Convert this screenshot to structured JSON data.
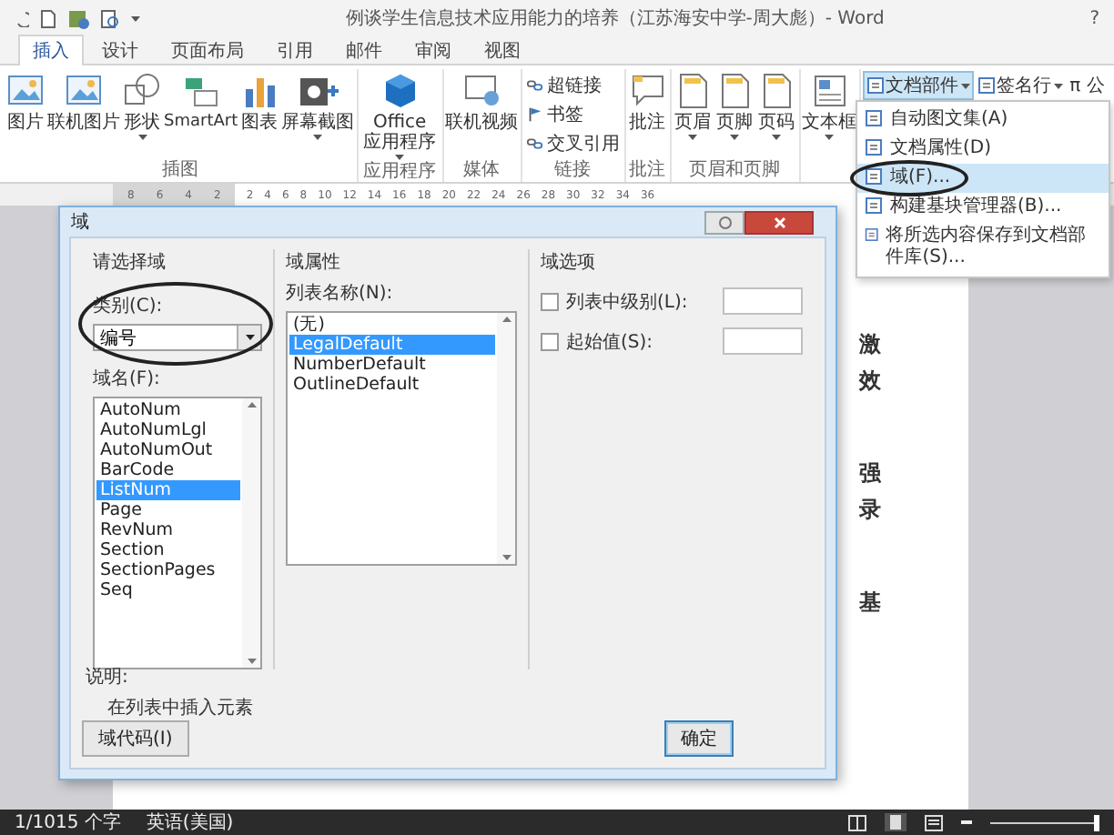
{
  "window": {
    "title": "例谈学生信息技术应用能力的培养（江苏海安中学-周大彪）- Word",
    "help": "?"
  },
  "tabs": [
    {
      "label": "插入",
      "selected": true
    },
    {
      "label": "设计",
      "selected": false
    },
    {
      "label": "页面布局",
      "selected": false
    },
    {
      "label": "引用",
      "selected": false
    },
    {
      "label": "邮件",
      "selected": false
    },
    {
      "label": "审阅",
      "selected": false
    },
    {
      "label": "视图",
      "selected": false
    }
  ],
  "ribbon_groups": [
    {
      "label": "插图",
      "buttons": [
        {
          "label": "图片",
          "kind": "large",
          "has_menu": false
        },
        {
          "label": "联机图片",
          "kind": "large",
          "has_menu": false
        },
        {
          "label": "形状",
          "kind": "large",
          "has_menu": true
        },
        {
          "label": "SmartArt",
          "kind": "large",
          "has_menu": false
        },
        {
          "label": "图表",
          "kind": "large",
          "has_menu": false
        },
        {
          "label": "屏幕截图",
          "kind": "large",
          "has_menu": true
        }
      ]
    },
    {
      "label": "应用程序",
      "buttons": [
        {
          "label": "Office 应用程序",
          "kind": "large",
          "has_menu": true
        }
      ]
    },
    {
      "label": "媒体",
      "buttons": [
        {
          "label": "联机视频",
          "kind": "large",
          "has_menu": false
        }
      ]
    },
    {
      "label": "链接",
      "buttons": [
        {
          "label": "超链接",
          "kind": "small",
          "has_menu": false
        },
        {
          "label": "书签",
          "kind": "small",
          "has_menu": false
        },
        {
          "label": "交叉引用",
          "kind": "small",
          "has_menu": false
        }
      ]
    },
    {
      "label": "批注",
      "buttons": [
        {
          "label": "批注",
          "kind": "large",
          "has_menu": false
        }
      ]
    },
    {
      "label": "页眉和页脚",
      "buttons": [
        {
          "label": "页眉",
          "kind": "large",
          "has_menu": true
        },
        {
          "label": "页脚",
          "kind": "large",
          "has_menu": true
        },
        {
          "label": "页码",
          "kind": "large",
          "has_menu": true
        }
      ]
    },
    {
      "buttons": [
        {
          "label": "文本框",
          "kind": "large",
          "has_menu": true
        }
      ]
    }
  ],
  "parts_buttons": [
    {
      "label": "文档部件",
      "has_menu": true,
      "selected": true
    },
    {
      "label": "签名行",
      "has_menu": true,
      "selected": false
    },
    {
      "label": "π 公",
      "has_menu": false,
      "selected": false
    }
  ],
  "parts_menu": [
    {
      "label": "自动图文集(A)",
      "selected": false,
      "circled": false
    },
    {
      "label": "文档属性(D)",
      "selected": false,
      "circled": false
    },
    {
      "label": "域(F)...",
      "selected": true,
      "circled": true
    },
    {
      "label": "构建基块管理器(B)...",
      "selected": false,
      "circled": false
    },
    {
      "label": "将所选内容保存到文档部件库(S)...",
      "selected": false,
      "circled": false
    }
  ],
  "ruler": {
    "left_labels": [
      "8",
      "6",
      "4",
      "2"
    ],
    "right_labels": [
      "2",
      "4",
      "6",
      "8",
      "10",
      "12",
      "14",
      "16",
      "18",
      "20",
      "22",
      "24",
      "26",
      "28",
      "30",
      "32",
      "34",
      "36"
    ]
  },
  "document": {
    "paragraphs": [
      [
        "激",
        "效"
      ],
      [
        "强",
        "录"
      ],
      [
        "基"
      ]
    ]
  },
  "dialog": {
    "title": "域",
    "field_section": {
      "heading": "请选择域",
      "category_label": "类别(C):",
      "category_value": "编号",
      "circled": true,
      "names_label": "域名(F):",
      "names": [
        {
          "label": "AutoNum",
          "selected": false
        },
        {
          "label": "AutoNumLgl",
          "selected": false
        },
        {
          "label": "AutoNumOut",
          "selected": false
        },
        {
          "label": "BarCode",
          "selected": false
        },
        {
          "label": "ListNum",
          "selected": true
        },
        {
          "label": "Page",
          "selected": false
        },
        {
          "label": "RevNum",
          "selected": false
        },
        {
          "label": "Section",
          "selected": false
        },
        {
          "label": "SectionPages",
          "selected": false
        },
        {
          "label": "Seq",
          "selected": false
        }
      ]
    },
    "properties": {
      "heading": "域属性",
      "list_label": "列表名称(N):",
      "items": [
        {
          "label": "(无)",
          "selected": false
        },
        {
          "label": "LegalDefault",
          "selected": true
        },
        {
          "label": "NumberDefault",
          "selected": false
        },
        {
          "label": "OutlineDefault",
          "selected": false
        }
      ]
    },
    "options": {
      "heading": "域选项",
      "checkboxes": [
        {
          "label": "列表中级别(L):",
          "checked": false
        },
        {
          "label": "起始值(S):",
          "checked": false
        }
      ]
    },
    "description_label": "说明:",
    "description": "在列表中插入元素",
    "buttons": [
      {
        "label": "域代码(I)",
        "kind": "secondary"
      },
      {
        "label": "确定",
        "kind": "default"
      }
    ]
  },
  "status_bar": {
    "word_count": "1/1015 个字",
    "language": "英语(美国)",
    "zoom": {
      "level": 0.96
    }
  }
}
